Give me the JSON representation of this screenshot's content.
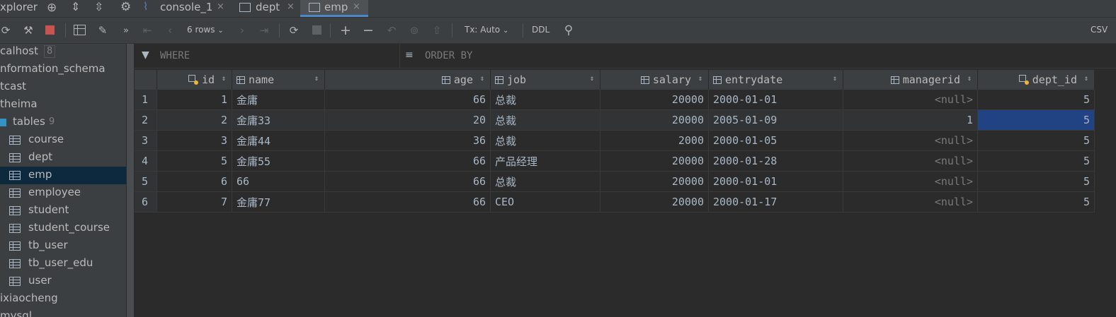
{
  "tabs": {
    "explorer_label": "xplorer",
    "console_label": "console_1",
    "dept_label": "dept",
    "emp_label": "emp",
    "close_glyph": "×"
  },
  "toolbar": {
    "rows_label": "6 rows",
    "tx_label": "Tx: Auto",
    "ddl_label": "DDL",
    "csv_label": "CSV"
  },
  "sidebar": {
    "items": [
      {
        "label": "calhost",
        "badge": "8"
      },
      {
        "label": "nformation_schema"
      },
      {
        "label": "tcast"
      },
      {
        "label": "theima"
      },
      {
        "label": "tables",
        "badge": "9"
      },
      {
        "label": "course"
      },
      {
        "label": "dept"
      },
      {
        "label": "emp"
      },
      {
        "label": "employee"
      },
      {
        "label": "student"
      },
      {
        "label": "student_course"
      },
      {
        "label": "tb_user"
      },
      {
        "label": "tb_user_edu"
      },
      {
        "label": "user"
      },
      {
        "label": "ixiaocheng"
      },
      {
        "label": "mysql"
      }
    ]
  },
  "filter": {
    "where_label": "WHERE",
    "orderby_label": "ORDER BY"
  },
  "grid": {
    "columns": [
      "id",
      "name",
      "age",
      "job",
      "salary",
      "entrydate",
      "managerid",
      "dept_id"
    ],
    "rows": [
      {
        "n": "1",
        "id": "1",
        "name": "金庸",
        "age": "66",
        "job": "总裁",
        "salary": "20000",
        "entrydate": "2000-01-01",
        "managerid": "<null>",
        "dept_id": "5"
      },
      {
        "n": "2",
        "id": "2",
        "name": "金庸33",
        "age": "20",
        "job": "总裁",
        "salary": "20000",
        "entrydate": "2005-01-09",
        "managerid": "1",
        "dept_id": "5"
      },
      {
        "n": "3",
        "id": "3",
        "name": "金庸44",
        "age": "36",
        "job": "总裁",
        "salary": "2000",
        "entrydate": "2000-01-05",
        "managerid": "<null>",
        "dept_id": "5"
      },
      {
        "n": "4",
        "id": "5",
        "name": "金庸55",
        "age": "66",
        "job": "产品经理",
        "salary": "20000",
        "entrydate": "2000-01-28",
        "managerid": "<null>",
        "dept_id": "5"
      },
      {
        "n": "5",
        "id": "6",
        "name": "66",
        "age": "66",
        "job": "总裁",
        "salary": "20000",
        "entrydate": "2000-01-01",
        "managerid": "<null>",
        "dept_id": "5"
      },
      {
        "n": "6",
        "id": "7",
        "name": "金庸77",
        "age": "66",
        "job": "CEO",
        "salary": "20000",
        "entrydate": "2000-01-17",
        "managerid": "<null>",
        "dept_id": "5"
      }
    ]
  },
  "colors": {
    "selection": "#214283",
    "tab_underline": "#4a88c7",
    "stop_red": "#c75450"
  },
  "icons": [
    "globe-icon",
    "expand-all-icon",
    "collapse-all-icon",
    "gear-icon",
    "console-icon",
    "table-icon",
    "refresh-icon",
    "edit-icon",
    "stop-icon",
    "search-icon",
    "filter-icon",
    "sort-icon",
    "key-icon",
    "column-icon"
  ]
}
